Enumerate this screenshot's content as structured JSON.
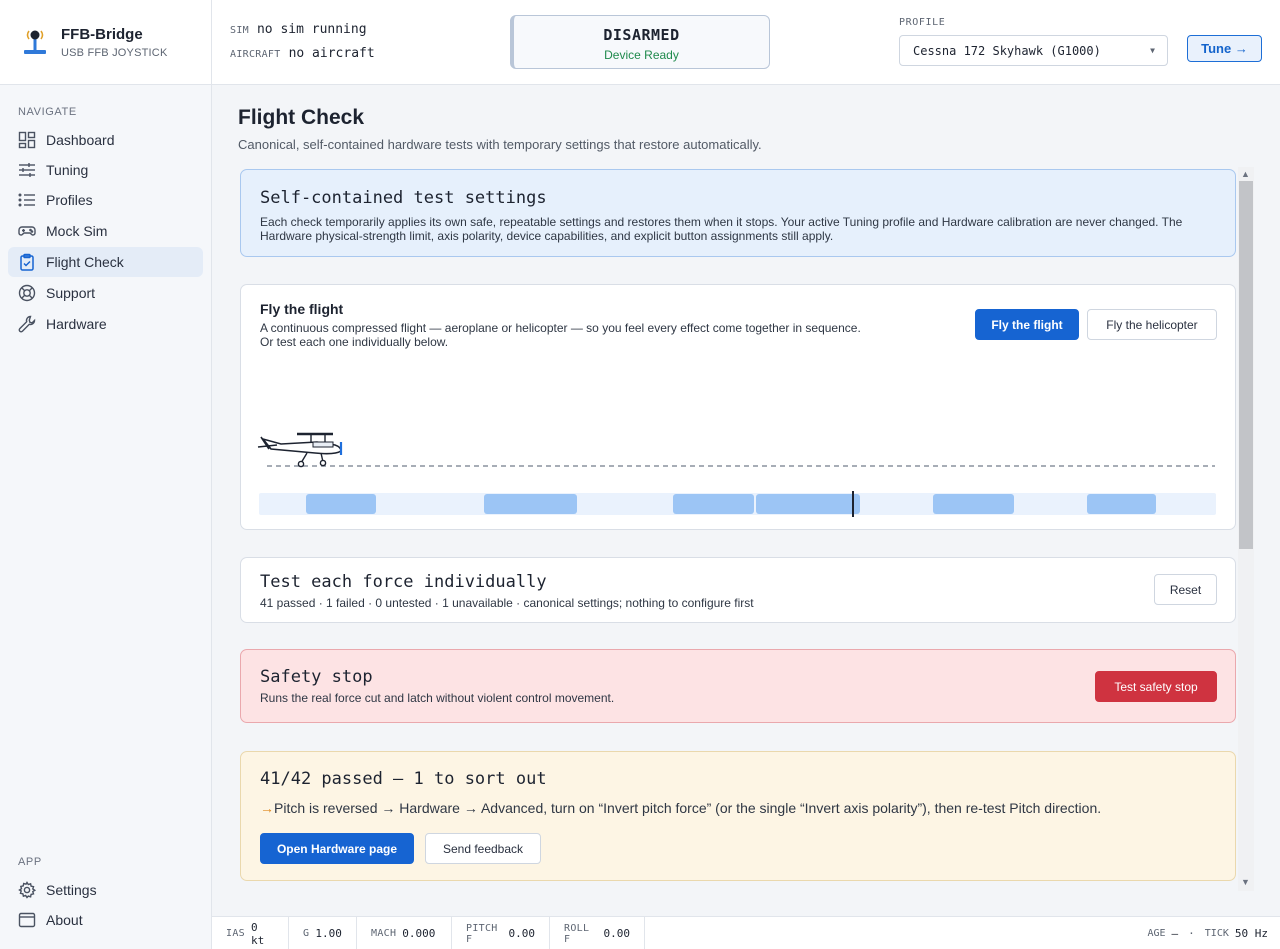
{
  "app": {
    "title": "FFB-Bridge",
    "subtitle": "USB FFB JOYSTICK"
  },
  "sidebar": {
    "navigate_heading": "NAVIGATE",
    "items": [
      {
        "label": "Dashboard",
        "icon": "dashboard-icon"
      },
      {
        "label": "Tuning",
        "icon": "sliders-icon"
      },
      {
        "label": "Profiles",
        "icon": "list-icon"
      },
      {
        "label": "Mock Sim",
        "icon": "gamepad-icon"
      },
      {
        "label": "Flight Check",
        "icon": "clipboard-check-icon",
        "active": true
      },
      {
        "label": "Support",
        "icon": "lifebuoy-icon"
      },
      {
        "label": "Hardware",
        "icon": "wrench-icon"
      }
    ],
    "app_heading": "APP",
    "app_items": [
      {
        "label": "Settings",
        "icon": "gear-icon"
      },
      {
        "label": "About",
        "icon": "window-icon"
      }
    ]
  },
  "header": {
    "sim_key": "SIM",
    "sim_value": "no sim running",
    "aircraft_key": "AIRCRAFT",
    "aircraft_value": "no aircraft",
    "status_main": "DISARMED",
    "status_sub": "Device Ready",
    "profile_label": "PROFILE",
    "profile_value": "Cessna 172 Skyhawk (G1000)",
    "tune_label": "Tune →"
  },
  "page": {
    "title": "Flight Check",
    "subtitle": "Canonical, self-contained hardware tests with temporary settings that restore automatically."
  },
  "info_card": {
    "title": "Self-contained test settings",
    "text": "Each check temporarily applies its own safe, repeatable settings and restores them when it stops. Your active Tuning profile and Hardware calibration are never changed. The Hardware physical-strength limit, axis polarity, device capabilities, and explicit button assignments still apply."
  },
  "fly_card": {
    "title": "Fly the flight",
    "line1": "A continuous compressed flight — aeroplane or helicopter — so you feel every effect come together in sequence.",
    "line2": "Or test each one individually below.",
    "btn_flight": "Fly the flight",
    "btn_heli": "Fly the helicopter"
  },
  "test_card": {
    "title": "Test each force individually",
    "summary": "41 passed · 1 failed · 0 untested · 1 unavailable · canonical settings; nothing to configure first",
    "reset_label": "Reset"
  },
  "safety_card": {
    "title": "Safety stop",
    "text": "Runs the real force cut and latch without violent control movement.",
    "btn_label": "Test safety stop"
  },
  "summary_card": {
    "title": "41/42 passed — 1 to sort out",
    "arrow": "→",
    "text": "Pitch is reversed → Hardware → Advanced, turn on “Invert pitch force” (or the single “Invert axis polarity”), then re-test Pitch direction.",
    "btn_primary": "Open Hardware page",
    "btn_secondary": "Send feedback"
  },
  "footer": {
    "ias_key": "IAS",
    "ias_value": "0 kt",
    "g_key": "G",
    "g_value": "1.00",
    "mach_key": "MACH",
    "mach_value": "0.000",
    "pitch_key": "PITCH F",
    "pitch_value": "0.00",
    "roll_key": "ROLL F",
    "roll_value": "0.00",
    "age_key": "AGE",
    "age_value": "—",
    "sep": "·",
    "tick_key": "TICK",
    "tick_value": "50 Hz"
  },
  "colors": {
    "accent": "#1664d2",
    "danger": "#cf3340",
    "success": "#1f8a4c"
  }
}
